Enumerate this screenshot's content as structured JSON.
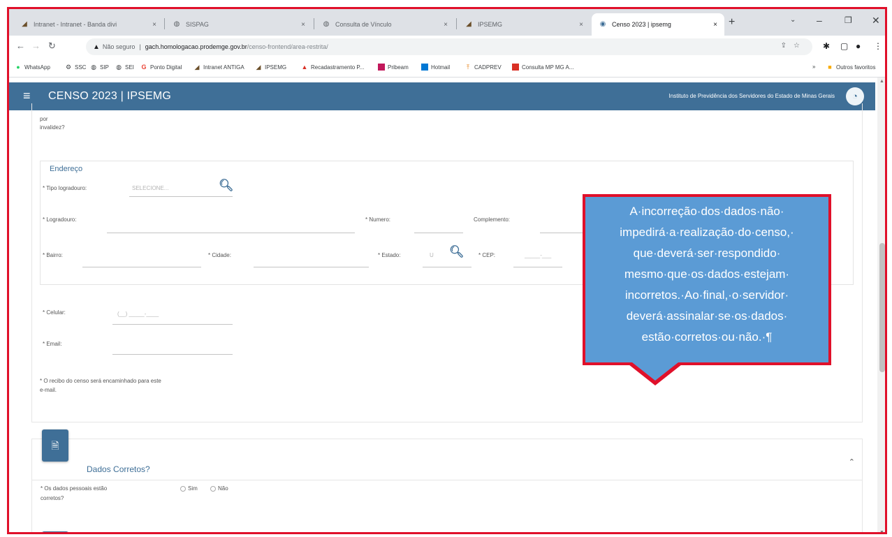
{
  "browser": {
    "tabs": [
      {
        "label": "Intranet - Intranet - Banda divi",
        "icon": "intranet-icon"
      },
      {
        "label": "SISPAG",
        "icon": "globe-icon"
      },
      {
        "label": "Consulta de Vínculo",
        "icon": "globe-icon"
      },
      {
        "label": "IPSEMG",
        "icon": "intranet-icon"
      },
      {
        "label": "Censo 2023 | ipsemg",
        "icon": "page-icon"
      }
    ],
    "address": {
      "security": "Não seguro",
      "host": "gach.homologacao.prodemge.gov.br",
      "path": "/censo-frontend/area-restrita/"
    },
    "bookmarks": [
      "WhatsApp",
      "SSC",
      "SIP",
      "SEI",
      "Ponto Digital",
      "Intranet ANTIGA",
      "IPSEMG",
      "Recadastramento P...",
      "Pribeam",
      "Hotmail",
      "CADPREV",
      "Consulta MP MG A..."
    ],
    "other_bookmarks": "Outros favoritos"
  },
  "app": {
    "title": "CENSO 2023 | IPSEMG",
    "institution": "Instituto de Previdência dos Servidores do Estado de Minas Gerais"
  },
  "form": {
    "prev_label_tail": "por",
    "prev_label_tail2": "invalidez?",
    "address": {
      "legend": "Endereço",
      "tipo_logradouro_label": "* Tipo logradouro:",
      "tipo_logradouro_placeholder": "SELECIONE...",
      "logradouro_label": "* Logradouro:",
      "numero_label": "* Numero:",
      "complemento_label": "Complemento:",
      "bairro_label": "* Bairro:",
      "cidade_label": "* Cidade:",
      "estado_label": "* Estado:",
      "estado_value": "U",
      "cep_label": "* CEP:",
      "cep_placeholder": "_____-___"
    },
    "celular_label": "* Celular:",
    "celular_placeholder": "(__) _____-____",
    "email_label": "* Email:",
    "recibo_note_1": "* O recibo do censo será encaminhado para este",
    "recibo_note_2": "e-mail."
  },
  "section_dados": {
    "title": "Dados Corretos?",
    "question_1": "* Os dados pessoais estão",
    "question_2": "corretos?",
    "option_sim": "Sim",
    "option_nao": "Não"
  },
  "callout": {
    "text": "A·incorreção·dos·dados·não· impedirá·a·realização·do·censo,· que·deverá·ser·respondido· mesmo·que·os·dados·estejam· incorretos.·Ao·final,·o·servidor· deverá·assinalar·se·os·dados· estão·corretos·ou·não.·¶"
  },
  "colors": {
    "header_blue": "#3f6f97",
    "callout_fill": "#5b9bd5",
    "callout_border": "#e0102a"
  }
}
